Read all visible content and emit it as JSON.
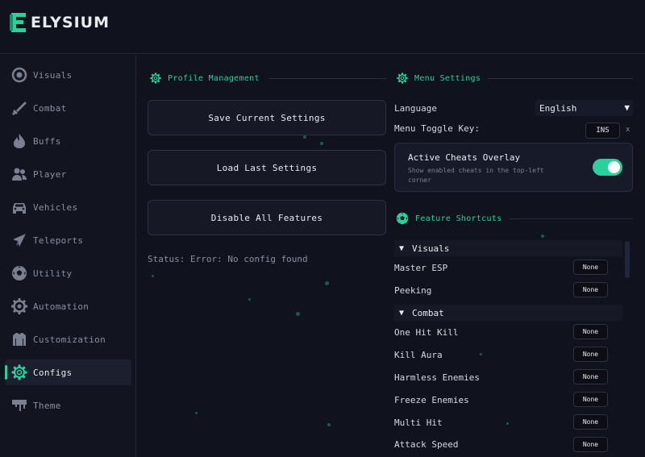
{
  "app": {
    "name": "ELYSIUM"
  },
  "sidebar": {
    "items": [
      {
        "label": "Visuals",
        "icon": "eye-icon"
      },
      {
        "label": "Combat",
        "icon": "sword-icon"
      },
      {
        "label": "Buffs",
        "icon": "flame-icon"
      },
      {
        "label": "Player",
        "icon": "users-icon"
      },
      {
        "label": "Vehicles",
        "icon": "car-icon"
      },
      {
        "label": "Teleports",
        "icon": "paper-plane-icon"
      },
      {
        "label": "Utility",
        "icon": "ball-icon"
      },
      {
        "label": "Automation",
        "icon": "cog-icon"
      },
      {
        "label": "Customization",
        "icon": "shirt-icon"
      },
      {
        "label": "Configs",
        "icon": "gear-icon",
        "active": true
      },
      {
        "label": "Theme",
        "icon": "paint-drip-icon"
      }
    ]
  },
  "profile": {
    "title": "Profile Management",
    "save_label": "Save Current Settings",
    "load_label": "Load Last Settings",
    "disable_label": "Disable All Features",
    "status": "Status: Error: No config found"
  },
  "menu_settings": {
    "title": "Menu Settings",
    "language_label": "Language",
    "language_value": "English",
    "toggle_key_label": "Menu Toggle Key:",
    "toggle_key_value": "INS",
    "toggle_key_clear": "x",
    "overlay_title": "Active Cheats Overlay",
    "overlay_desc": "Show enabled cheats in the top-left corner",
    "overlay_enabled": true
  },
  "shortcuts": {
    "title": "Feature Shortcuts",
    "groups": [
      {
        "name": "Visuals",
        "items": [
          "Master ESP",
          "Peeking"
        ]
      },
      {
        "name": "Combat",
        "items": [
          "One Hit Kill",
          "Kill Aura",
          "Harmless Enemies",
          "Freeze Enemies",
          "Multi Hit",
          "Attack Speed"
        ]
      }
    ],
    "none_label": "None"
  },
  "colors": {
    "accent": "#2ad19a",
    "background": "#10121d",
    "card": "#161826"
  }
}
